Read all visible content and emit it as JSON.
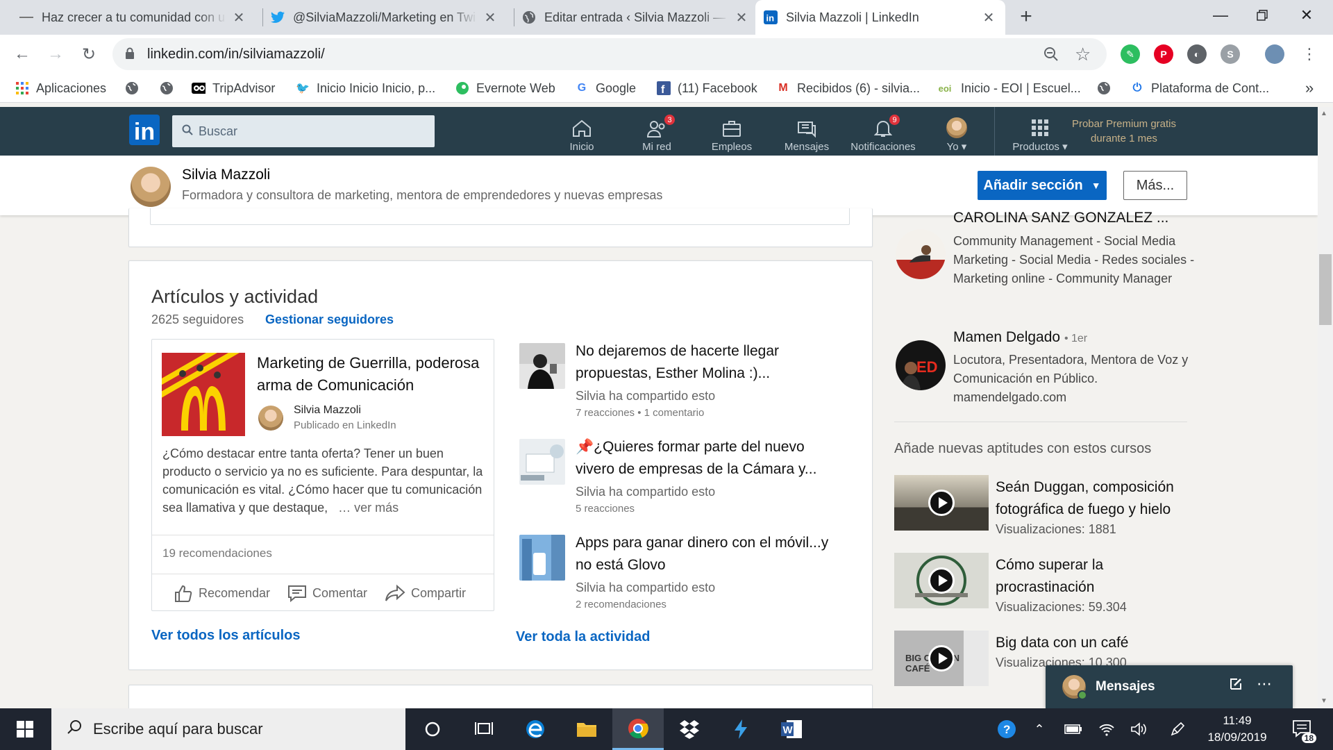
{
  "browser": {
    "tabs": [
      {
        "title": "Haz crecer a tu comunidad con u",
        "icon": "dash-icon"
      },
      {
        "title": "@SilviaMazzoli/Marketing en Twi",
        "icon": "twitter-icon"
      },
      {
        "title": "Editar entrada ‹ Silvia Mazzoli —",
        "icon": "globe-icon"
      },
      {
        "title": "Silvia Mazzoli | LinkedIn",
        "icon": "linkedin-icon"
      }
    ],
    "url": "linkedin.com/in/silviamazzoli/",
    "bookmarks": [
      {
        "label": "Aplicaciones",
        "icon": "apps-grid-icon"
      },
      {
        "label": "",
        "icon": "globe-icon"
      },
      {
        "label": "",
        "icon": "globe-icon"
      },
      {
        "label": "TripAdvisor",
        "icon": "tripadvisor-icon"
      },
      {
        "label": "Inicio Inicio Inicio, p...",
        "icon": "twitter-icon"
      },
      {
        "label": "Evernote Web",
        "icon": "evernote-icon"
      },
      {
        "label": "Google",
        "icon": "google-icon"
      },
      {
        "label": "(11) Facebook",
        "icon": "facebook-icon"
      },
      {
        "label": "Recibidos (6) - silvia...",
        "icon": "gmail-icon"
      },
      {
        "label": "Inicio - EOI | Escuel...",
        "icon": "eoi-icon"
      },
      {
        "label": "",
        "icon": "globe-icon"
      },
      {
        "label": "Plataforma de Cont...",
        "icon": "power-icon"
      }
    ],
    "more_bookmarks": "»"
  },
  "linkedin": {
    "logo": "in",
    "search_placeholder": "Buscar",
    "nav": [
      {
        "label": "Inicio",
        "icon": "home-icon",
        "badge": ""
      },
      {
        "label": "Mi red",
        "icon": "network-icon",
        "badge": "3"
      },
      {
        "label": "Empleos",
        "icon": "briefcase-icon",
        "badge": ""
      },
      {
        "label": "Mensajes",
        "icon": "messages-icon",
        "badge": ""
      },
      {
        "label": "Notificaciones",
        "icon": "bell-icon",
        "badge": "9"
      },
      {
        "label": "Yo ▾",
        "icon": "avatar-icon",
        "badge": ""
      },
      {
        "label": "Productos ▾",
        "icon": "grid-icon",
        "badge": ""
      }
    ],
    "premium": [
      "Probar Premium gratis",
      "durante 1 mes"
    ]
  },
  "profile": {
    "name": "Silvia Mazzoli",
    "headline": "Formadora y consultora de marketing, mentora de emprendedores y nuevas empresas",
    "add_section": "Añadir sección",
    "more": "Más..."
  },
  "articles": {
    "title": "Artículos y actividad",
    "followers": "2625 seguidores",
    "manage": "Gestionar seguidores",
    "featured": {
      "title": "Marketing de Guerrilla, poderosa arma de Comunicación",
      "author": "Silvia Mazzoli",
      "published": "Publicado en LinkedIn",
      "body": "¿Cómo destacar entre tanta oferta? Tener un buen producto o servicio ya no es suficiente. Para despuntar, la comunicación es vital. ¿Cómo hacer que tu comunicación sea llamativa y que destaque,",
      "see_more": "… ver más",
      "recommendations": "19 recomendaciones",
      "actions": [
        "Recomendar",
        "Comentar",
        "Compartir"
      ]
    },
    "activity": [
      {
        "title": "No dejaremos de hacerte llegar propuestas, Esther Molina :)...",
        "shared": "Silvia ha compartido esto",
        "meta": "7 reacciones • 1 comentario"
      },
      {
        "title": "📌¿Quieres formar parte del nuevo vivero de empresas de la Cámara y...",
        "shared": "Silvia ha compartido esto",
        "meta": "5 reacciones"
      },
      {
        "title": "Apps para ganar dinero con el móvil...y no está Glovo",
        "shared": "Silvia ha compartido esto",
        "meta": "2 recomendaciones"
      }
    ],
    "see_all_articles": "Ver todos los artículos",
    "see_all_activity": "Ver toda la actividad"
  },
  "rail": {
    "people": [
      {
        "name": "CAROLINA SANZ GONZALEZ ...",
        "degree": "",
        "text": "Community Management - Social Media Marketing - Social Media - Redes sociales - Marketing online - Community Manager"
      },
      {
        "name": "Mamen Delgado",
        "degree": "• 1er",
        "text": "Locutora, Presentadora, Mentora de Voz y Comunicación en Público. mamendelgado.com"
      }
    ],
    "courses_header": "Añade nuevas aptitudes con estos cursos",
    "courses": [
      {
        "title": "Seán Duggan, composición fotográfica de fuego y hielo",
        "views": "Visualizaciones: 1881",
        "thumb_text": ""
      },
      {
        "title": "Cómo superar la procrastinación",
        "views": "Visualizaciones: 59.304",
        "thumb_text": ""
      },
      {
        "title": "Big data con un café",
        "views": "Visualizaciones: 10.300",
        "thumb_text": "BIG CON UN CAFÉ"
      }
    ]
  },
  "messaging": {
    "label": "Mensajes"
  },
  "taskbar": {
    "search_placeholder": "Escribe aquí para buscar",
    "time": "11:49",
    "date": "18/09/2019",
    "notifications": "18"
  },
  "colors": {
    "linkedin_nav": "#283e4a",
    "linkedin_blue": "#0a66c2",
    "premium_gold": "#c7b188",
    "badge_red": "#e0323b"
  }
}
